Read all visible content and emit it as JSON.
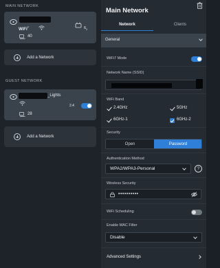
{
  "main_network": {
    "section_title": "MAIN NETWORK",
    "wifi_badge": "WiFi",
    "wifi_badge_sup": "7",
    "band_label": "6",
    "band_sub": "2",
    "client_count": "40",
    "add_label": "Add a Network"
  },
  "guest_network": {
    "section_title": "GUEST NETWORK",
    "name_suffix": "_Lights",
    "band_label": "2.4",
    "client_count": "28",
    "toggle_on": true,
    "add_label": "Add a Network"
  },
  "panel": {
    "title": "Main Network",
    "tabs": [
      {
        "label": "Network",
        "active": true
      },
      {
        "label": "Clients",
        "active": false
      }
    ],
    "general_label": "General",
    "wifi7_mode_label": "WiFi7 Mode",
    "wifi7_mode_on": true,
    "ssid_label": "Network Name (SSID)",
    "wifi_band_label": "WiFi Band",
    "bands": [
      {
        "label": "2.4GHz",
        "checked": true,
        "style": "tick"
      },
      {
        "label": "5GHz",
        "checked": true,
        "style": "tick"
      },
      {
        "label": "6GHz-1",
        "checked": true,
        "style": "tick"
      },
      {
        "label": "6GHz-2",
        "checked": true,
        "style": "box"
      }
    ],
    "security_label": "Security",
    "security_options": [
      {
        "label": "Open",
        "selected": false
      },
      {
        "label": "Password",
        "selected": true
      }
    ],
    "auth_label": "Authentication Method",
    "auth_value": "WPA2/WPA3-Personal",
    "help_glyph": "?",
    "wireless_security_label": "Wireless Security",
    "password_mask": "••••••••••",
    "wifi_scheduling_label": "WiFi Scheduling",
    "wifi_scheduling_on": false,
    "mac_filter_label": "Enable MAC Filter",
    "mac_filter_value": "Disable",
    "advanced_label": "Advanced Settings"
  },
  "colors": {
    "accent": "#2f7fd8",
    "card": "#3a434c",
    "background": "#1b2027"
  },
  "icons": [
    "router-icon",
    "wifi-icon",
    "clients-icon",
    "band-icon",
    "add-circle-icon",
    "trash-icon",
    "chevron-down-icon",
    "chevron-right-icon",
    "lock-icon",
    "eye-off-icon",
    "help-icon"
  ]
}
